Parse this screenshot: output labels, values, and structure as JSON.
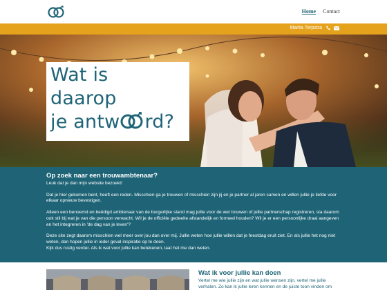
{
  "header": {
    "logo_icon": "wedding-rings-icon",
    "nav": [
      {
        "label": "Home",
        "active": true
      },
      {
        "label": "Contact",
        "active": false
      }
    ]
  },
  "contact_bar": {
    "name": "Marita Terpstra",
    "icons": [
      "phone-icon",
      "mail-icon"
    ],
    "color": "#e5a21c"
  },
  "hero": {
    "line1": "Wat is",
    "line2": "daarop",
    "line3_start": "je antw",
    "line3_end": "rd?",
    "rings_icon": "wedding-rings-icon"
  },
  "intro": {
    "title": "Op zoek naar een trouwambtenaar?",
    "p1": "Leuk dat je dan mijn website bezoekt!",
    "p2": "Dat je hier gekomen bent, heeft een reden. Misschien ga je trouwen of misschien zijn jij en je partner al jaren samen en willen jullie je liefde voor elkaar opnieuw bevestigen.",
    "p3": "Alleen een benoemd en beëdigd ambtenaar van de burgerlijke stand mag jullie voor de wet trouwen of jullie partnerschap registreren, sta daarom ook stil bij wat je van die persoon verwacht. Wil je de officiële gedeelte afstandelijk en formeel houden? Wil je er een persoonlijke draai aangeven en het integreren in 'de dag van je leven'?",
    "p4a": "Deze site zegt daarom misschien wel meer over jou dan over mij. Jullie weten hoe jullie willen dat je feestdag eruit ziet. En als jullie het nog niet weten, dan hopen jullie in ieder geval inspiratie op te doen.",
    "p4b": "Kijk dus rustig verder. Als ik wat voor jullie kan betekenen, laat het me dan weten."
  },
  "doen": {
    "title": "Wat ik voor jullie kan doen",
    "text": "Vertel me wie jullie zijn en wat jullie wensen zijn, vertel me jullie verhalen. Zo kan ik jullie leren kennen en de juiste toon vinden om"
  },
  "colors": {
    "brand_teal": "#1e6476",
    "accent_orange": "#e5a21c"
  }
}
